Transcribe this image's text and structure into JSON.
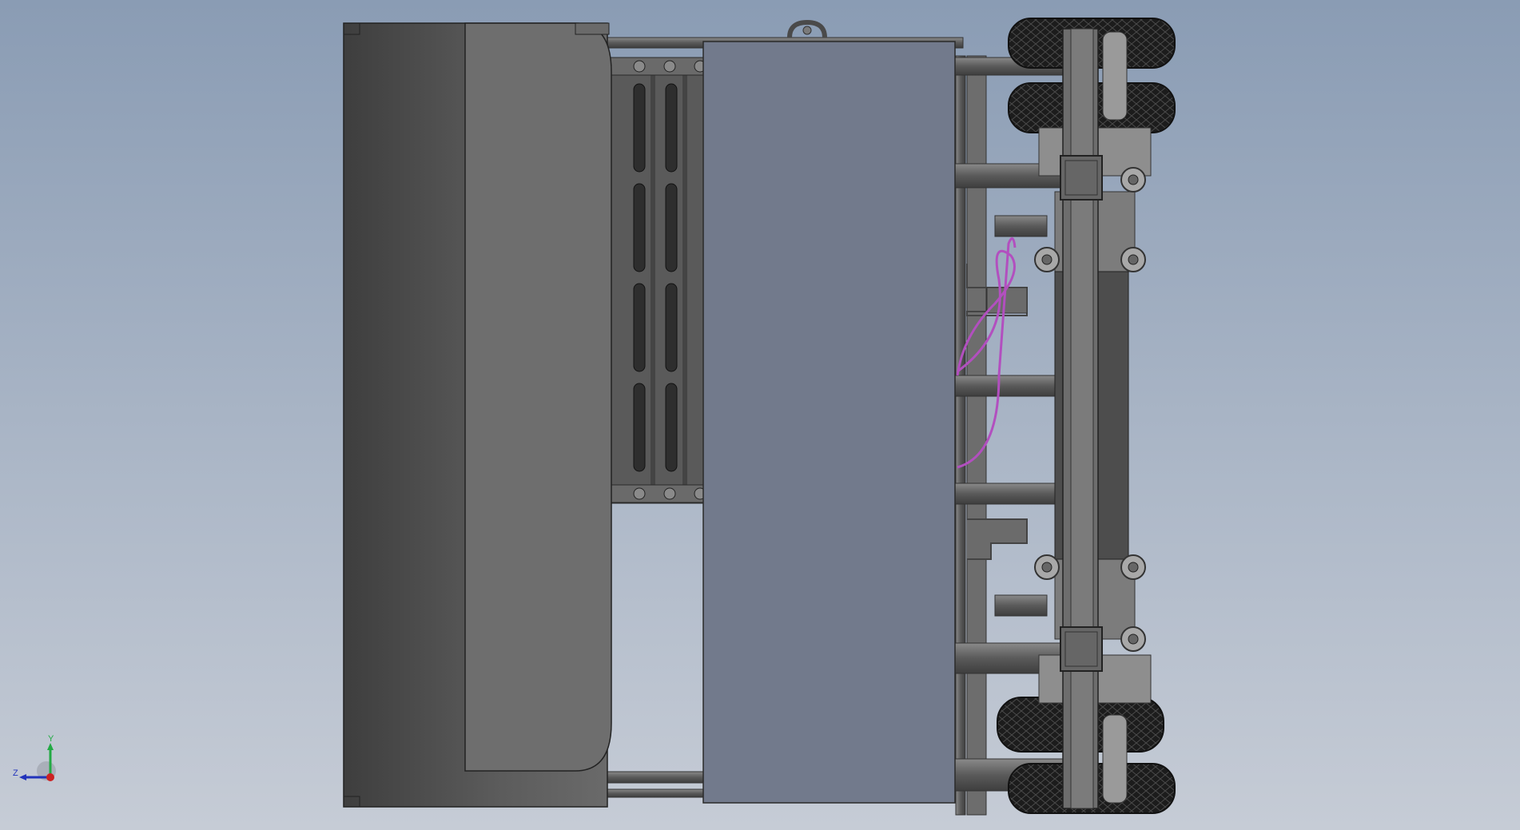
{
  "viewport": {
    "background_top": "#8a9cb4",
    "background_bottom": "#c6ccd6"
  },
  "model": {
    "body_color": "#5e5e5e",
    "panel_color": "#727a8c",
    "frame_color": "#6b6b6b",
    "tire_color": "#1e1e1e",
    "cable_color": "#b24fbf"
  },
  "triad": {
    "x_color": "#cc2222",
    "y_color": "#22aa44",
    "z_color": "#2233bb",
    "labels": {
      "y": "Y",
      "z": "Z"
    }
  }
}
